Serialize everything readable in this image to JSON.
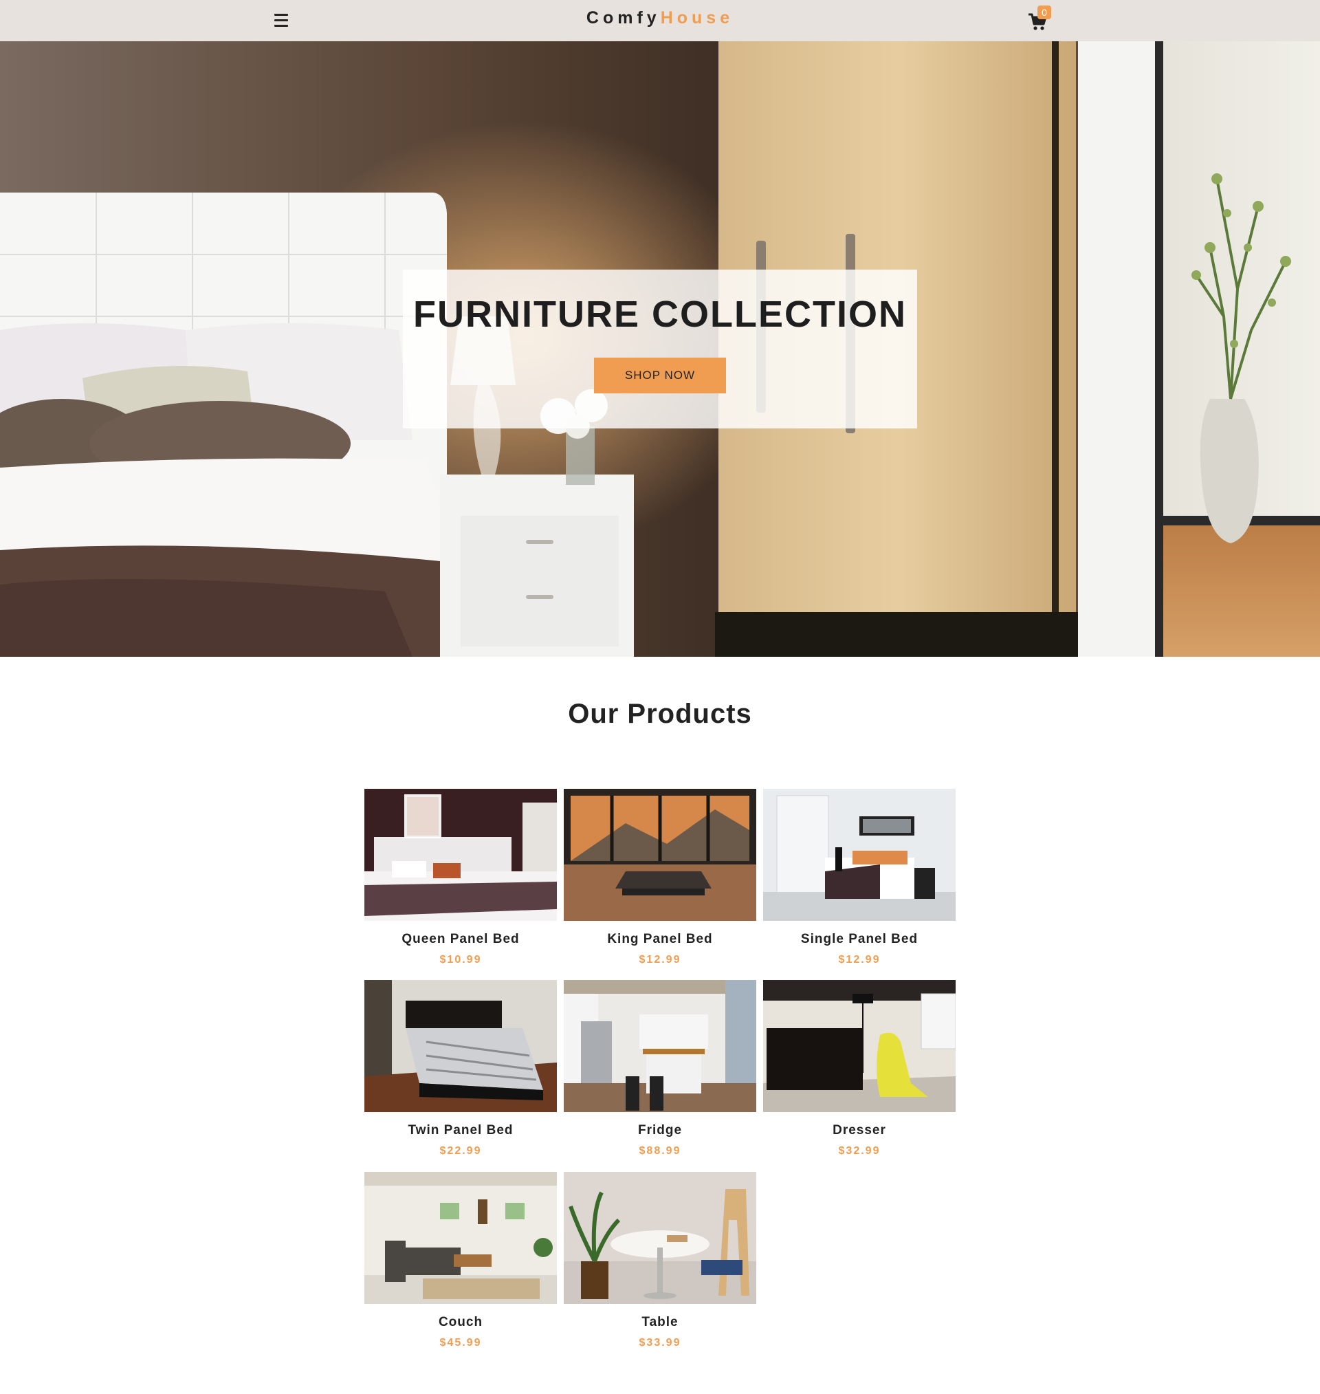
{
  "navbar": {
    "logo_part1": "Comfy",
    "logo_part2": "House",
    "cart_count": "0"
  },
  "hero": {
    "title": "FURNITURE COLLECTION",
    "button_label": "SHOP NOW"
  },
  "products_section": {
    "title": "Our Products",
    "items": [
      {
        "name": "Queen Panel Bed",
        "price": "$10.99"
      },
      {
        "name": "King Panel Bed",
        "price": "$12.99"
      },
      {
        "name": "Single Panel Bed",
        "price": "$12.99"
      },
      {
        "name": "Twin Panel Bed",
        "price": "$22.99"
      },
      {
        "name": "Fridge",
        "price": "$88.99"
      },
      {
        "name": "Dresser",
        "price": "$32.99"
      },
      {
        "name": "Couch",
        "price": "$45.99"
      },
      {
        "name": "Table",
        "price": "$33.99"
      }
    ]
  },
  "colors": {
    "accent": "#f09d51",
    "navbar_bg": "#e7e2dd",
    "text": "#222222"
  },
  "icons": [
    "menu-icon",
    "cart-icon"
  ]
}
